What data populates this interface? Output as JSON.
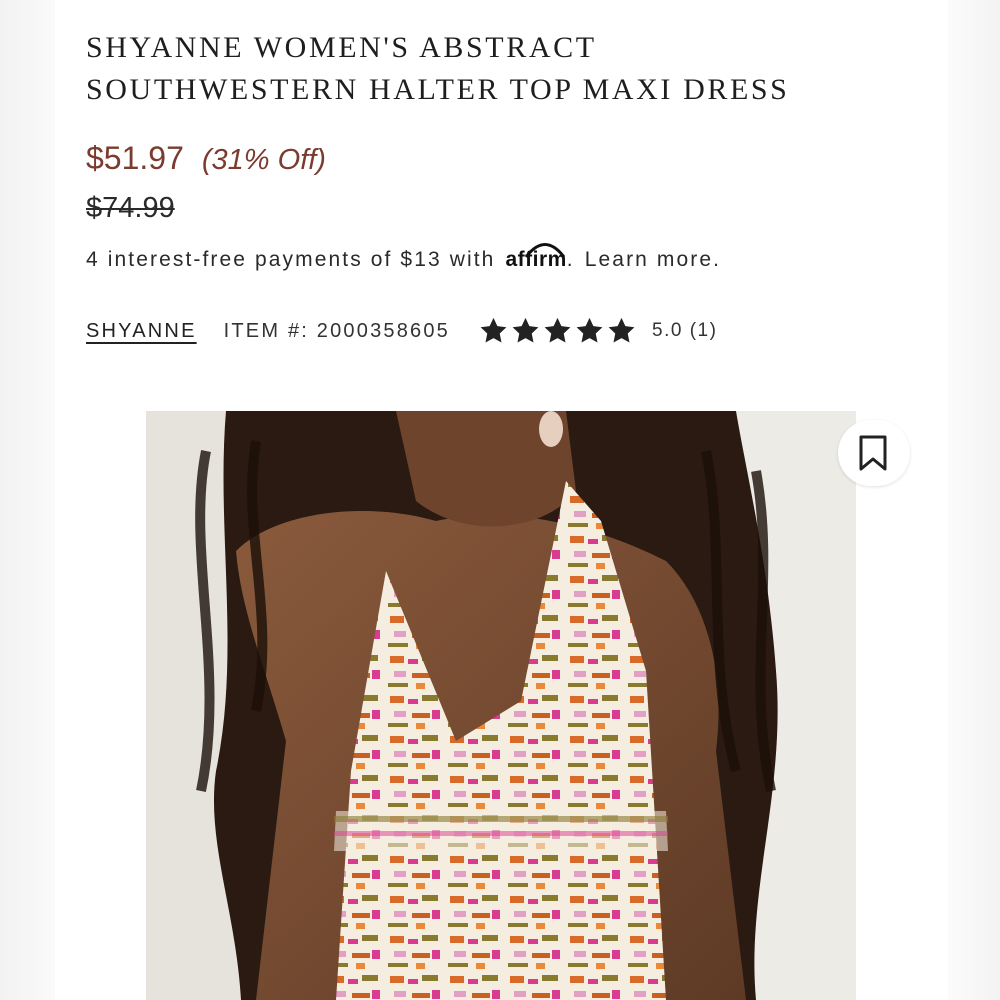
{
  "product": {
    "title_line1": "SHYANNE WOMEN'S ABSTRACT",
    "title_line2": "SOUTHWESTERN HALTER TOP MAXI DRESS",
    "sale_price": "$51.97",
    "discount": "(31% Off)",
    "original_price": "$74.99"
  },
  "financing": {
    "text": "4 interest-free payments of $13 with",
    "logo_text": "affirm",
    "suffix": ".",
    "learn_more": "Learn more."
  },
  "meta": {
    "brand": "SHYANNE",
    "item_number": "ITEM #: 2000358605",
    "rating_stars": 5,
    "rating_text": "5.0 (1)"
  },
  "colors": {
    "price": "#7b3b2e",
    "star": "#222222"
  },
  "icons": {
    "bookmark": "bookmark-icon",
    "star": "star-icon"
  }
}
